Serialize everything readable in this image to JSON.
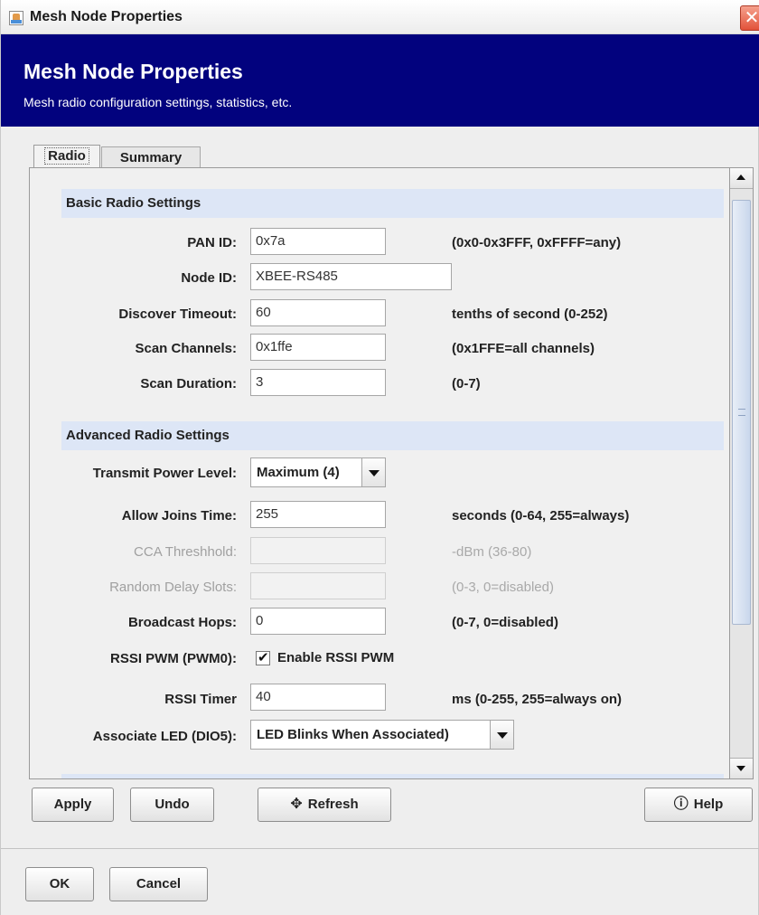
{
  "window": {
    "title": "Mesh Node Properties"
  },
  "banner": {
    "title": "Mesh Node Properties",
    "subtitle": "Mesh radio configuration settings, statistics, etc."
  },
  "tabs": [
    {
      "label": "Radio",
      "selected": true
    },
    {
      "label": "Summary",
      "selected": false
    }
  ],
  "basic": {
    "header": "Basic Radio Settings",
    "pan_id": {
      "label": "PAN ID:",
      "value": "0x7a",
      "hint": "(0x0-0x3FFF, 0xFFFF=any)"
    },
    "node_id": {
      "label": "Node ID:",
      "value": "XBEE-RS485"
    },
    "discover_timeout": {
      "label": "Discover Timeout:",
      "value": "60",
      "hint": "tenths of second (0-252)"
    },
    "scan_channels": {
      "label": "Scan Channels:",
      "value": "0x1ffe",
      "hint": "(0x1FFE=all channels)"
    },
    "scan_duration": {
      "label": "Scan Duration:",
      "value": "3",
      "hint": "(0-7)"
    }
  },
  "advanced": {
    "header": "Advanced Radio Settings",
    "transmit_power": {
      "label": "Transmit Power Level:",
      "value": "Maximum (4)"
    },
    "allow_joins": {
      "label": "Allow Joins Time:",
      "value": "255",
      "hint": "seconds (0-64, 255=always)"
    },
    "cca_threshold": {
      "label": "CCA Threshhold:",
      "value": "",
      "hint": "-dBm (36-80)"
    },
    "random_delay": {
      "label": "Random Delay Slots:",
      "value": "",
      "hint": "(0-3, 0=disabled)"
    },
    "broadcast_hops": {
      "label": "Broadcast Hops:",
      "value": "0",
      "hint": "(0-7, 0=disabled)"
    },
    "rssi_pwm": {
      "label": "RSSI PWM (PWM0):",
      "checkbox_label": "Enable RSSI PWM",
      "checked": true
    },
    "rssi_timer": {
      "label": "RSSI Timer",
      "value": "40",
      "hint": "ms (0-255, 255=always on)"
    },
    "associate_led": {
      "label": "Associate LED (DIO5):",
      "value": "LED Blinks When Associated)"
    }
  },
  "actions": {
    "apply": "Apply",
    "undo": "Undo",
    "refresh": "Refresh",
    "help": "Help"
  },
  "dialog": {
    "ok": "OK",
    "cancel": "Cancel"
  },
  "colors": {
    "banner": "#02027e",
    "section_header": "#dde6f6",
    "close": "#e2523a"
  }
}
